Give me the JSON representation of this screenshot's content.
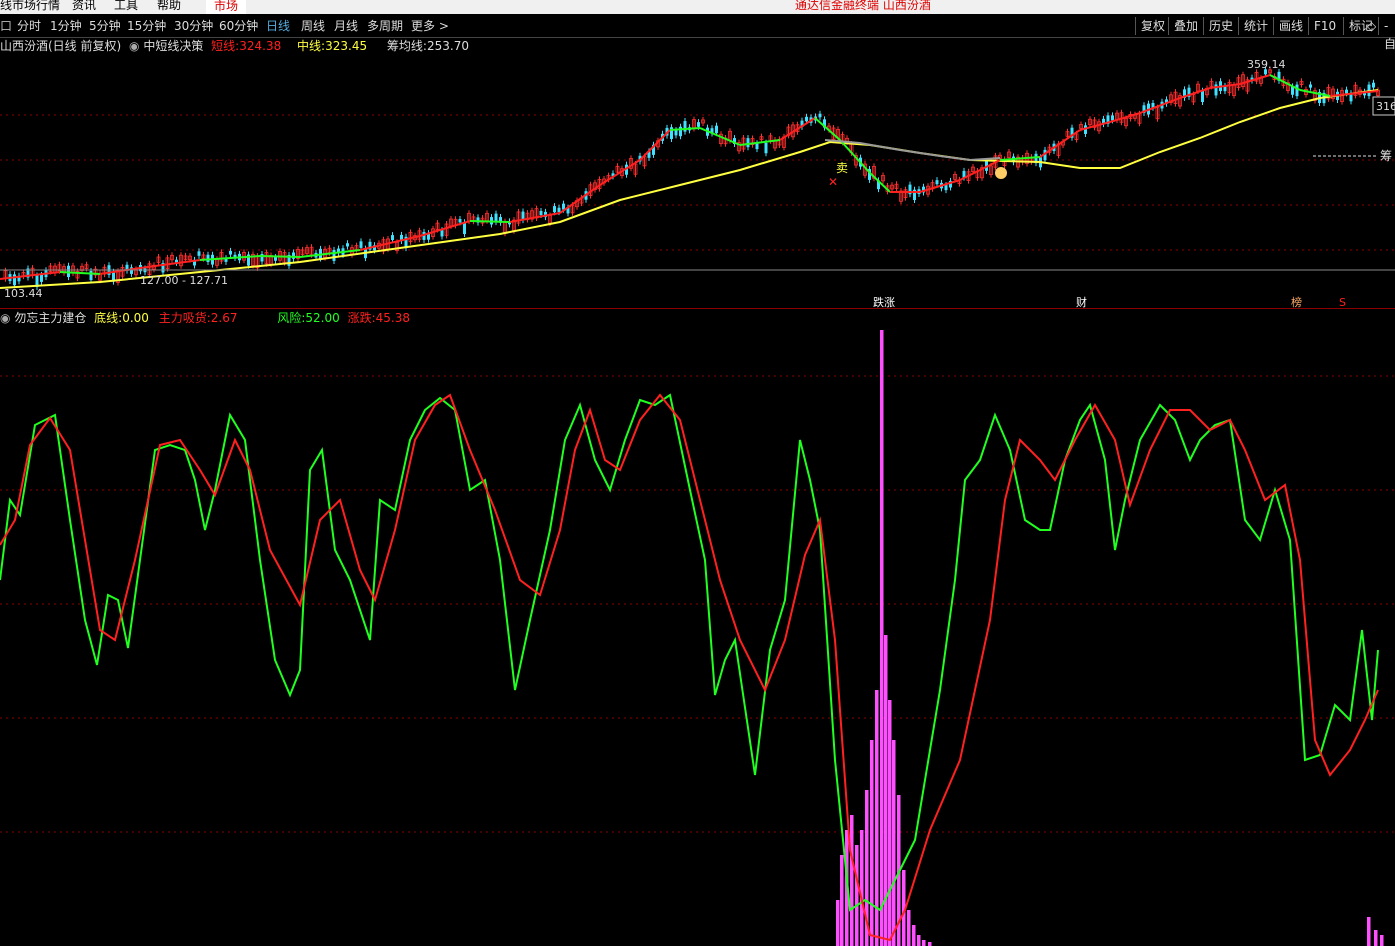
{
  "menu": {
    "items": [
      "线市场行情",
      "资讯",
      "工具",
      "帮助"
    ],
    "market_tab": "市场",
    "app_title": "通达信金融终端  山西汾酒"
  },
  "toolbar": {
    "left_mark": "口",
    "periods": [
      "分时",
      "1分钟",
      "5分钟",
      "15分钟",
      "30分钟",
      "60分钟",
      "日线",
      "周线",
      "月线",
      "多周期",
      "更多 >"
    ],
    "active_period": "日线",
    "right_buttons": [
      "复权",
      "叠加",
      "历史",
      "统计",
      "画线",
      "F10",
      "标记",
      "◇",
      "-自"
    ]
  },
  "main_panel": {
    "title": "山西汾酒(日线 前复权)",
    "indicator_name": "中短线决策",
    "short_label": "短线:",
    "short_value": "324.38",
    "mid_label": "中线:",
    "mid_value": "323.45",
    "chip_label": "筹均线:",
    "chip_value": "253.70",
    "high_mark": "359.14",
    "low_mark_left": "103.44",
    "low_mark_mid": "127.00 - 127.71",
    "right_price": "316",
    "right_chip": "筹",
    "sell_mark": "卖",
    "signal_jump": "跌涨",
    "signal_cai": "财",
    "signal_bang": "榜",
    "signal_s": "S"
  },
  "sub_panel": {
    "title": "勿忘主力建仓",
    "base_label": "底线:",
    "base_value": "0.00",
    "main_label": "主力吸货:",
    "main_value": "2.67",
    "risk_label": "风险:",
    "risk_value": "52.00",
    "rise_label": "涨跌:",
    "rise_value": "45.38"
  },
  "colors": {
    "red": "#ff2020",
    "green": "#20ff20",
    "yellow": "#ffff40",
    "magenta": "#ff50ff",
    "cyan": "#40e0ff",
    "grid": "#8b0000"
  }
}
